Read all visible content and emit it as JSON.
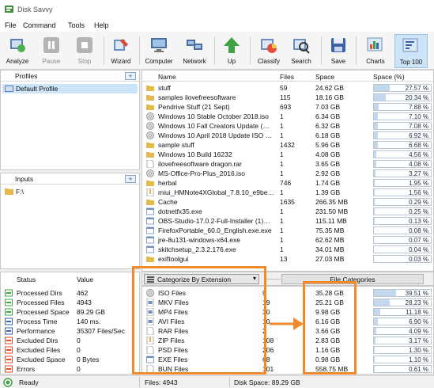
{
  "app": {
    "title": "Disk Savvy"
  },
  "menu": [
    "File",
    "Command",
    "Tools",
    "Help"
  ],
  "toolbar": [
    {
      "label": "Analyze",
      "icon": "analyze-icon",
      "enabled": true
    },
    {
      "label": "Pause",
      "icon": "pause-icon",
      "enabled": false
    },
    {
      "label": "Stop",
      "icon": "stop-icon",
      "enabled": false
    },
    {
      "label": "Wizard",
      "icon": "wizard-icon",
      "enabled": true
    },
    {
      "label": "Computer",
      "icon": "computer-icon",
      "enabled": true
    },
    {
      "label": "Network",
      "icon": "network-icon",
      "enabled": true
    },
    {
      "label": "Up",
      "icon": "up-arrow-icon",
      "enabled": true
    },
    {
      "label": "Classify",
      "icon": "classify-icon",
      "enabled": true
    },
    {
      "label": "Search",
      "icon": "search-icon",
      "enabled": true
    },
    {
      "label": "Save",
      "icon": "save-icon",
      "enabled": true
    },
    {
      "label": "Charts",
      "icon": "charts-icon",
      "enabled": true
    },
    {
      "label": "Top 100",
      "icon": "top100-icon",
      "enabled": true,
      "active": true
    }
  ],
  "profiles": {
    "header": "Profiles",
    "items": [
      "Default Profile"
    ]
  },
  "inputs": {
    "header": "Inputs",
    "items": [
      "F:\\"
    ]
  },
  "status_panel": {
    "col_status": "Status",
    "col_value": "Value",
    "rows": [
      {
        "label": "Processed Dirs",
        "value": "462"
      },
      {
        "label": "Processed Files",
        "value": "4943"
      },
      {
        "label": "Processed Space",
        "value": "89.29 GB"
      },
      {
        "label": "Process Time",
        "value": "140 ms."
      },
      {
        "label": "Performance",
        "value": "35307 Files/Sec"
      },
      {
        "label": "Excluded Dirs",
        "value": "0"
      },
      {
        "label": "Excluded Files",
        "value": "0"
      },
      {
        "label": "Excluded Space",
        "value": "0 Bytes"
      },
      {
        "label": "Errors",
        "value": "0"
      }
    ]
  },
  "file_list": {
    "columns": {
      "name": "Name",
      "files": "Files",
      "space": "Space",
      "pct": "Space (%)"
    },
    "rows": [
      {
        "name": "stuff",
        "type": "folder",
        "files": "59",
        "space": "24.62 GB",
        "pct": "27.57 %",
        "frac": 0.2757
      },
      {
        "name": "samples ilovefreesoftware",
        "type": "folder",
        "files": "115",
        "space": "18.16 GB",
        "pct": "20.34 %",
        "frac": 0.2034
      },
      {
        "name": "Pendrive Stuff (21 Sept)",
        "type": "folder",
        "files": "693",
        "space": "7.03 GB",
        "pct": "7.88 %",
        "frac": 0.0788
      },
      {
        "name": "Windows 10 Stable October 2018.iso",
        "type": "disc",
        "files": "1",
        "space": "6.34 GB",
        "pct": "7.10 %",
        "frac": 0.071
      },
      {
        "name": "Windows 10 Fall Creators Update (…",
        "type": "disc",
        "files": "1",
        "space": "6.32 GB",
        "pct": "7.08 %",
        "frac": 0.0708
      },
      {
        "name": "Windows 10 April 2018 Update ISO …",
        "type": "disc",
        "files": "1",
        "space": "6.18 GB",
        "pct": "6.92 %",
        "frac": 0.0692
      },
      {
        "name": "sample stuff",
        "type": "folder",
        "files": "1432",
        "space": "5.96 GB",
        "pct": "6.68 %",
        "frac": 0.0668
      },
      {
        "name": "Windows 10 Build 16232",
        "type": "folder",
        "files": "1",
        "space": "4.08 GB",
        "pct": "4.56 %",
        "frac": 0.0456
      },
      {
        "name": "ilovefreesoftware dragon.rar",
        "type": "file",
        "files": "1",
        "space": "3.65 GB",
        "pct": "4.08 %",
        "frac": 0.0408
      },
      {
        "name": "MS-Office-Pro-Plus_2016.iso",
        "type": "disc",
        "files": "1",
        "space": "2.92 GB",
        "pct": "3.27 %",
        "frac": 0.0327
      },
      {
        "name": "herbal",
        "type": "folder",
        "files": "746",
        "space": "1.74 GB",
        "pct": "1.95 %",
        "frac": 0.0195
      },
      {
        "name": "miui_HMNote4XGlobal_7.8.10_e9be…",
        "type": "zip",
        "files": "1",
        "space": "1.39 GB",
        "pct": "1.56 %",
        "frac": 0.0156
      },
      {
        "name": "Cache",
        "type": "folder",
        "files": "1635",
        "space": "266.35 MB",
        "pct": "0.29 %",
        "frac": 0.0029
      },
      {
        "name": "dotnetfx35.exe",
        "type": "exe",
        "files": "1",
        "space": "231.50 MB",
        "pct": "0.25 %",
        "frac": 0.0025
      },
      {
        "name": "OBS-Studio-17.0.2-Full-Installer (1)…",
        "type": "exe",
        "files": "1",
        "space": "115.11 MB",
        "pct": "0.13 %",
        "frac": 0.0013
      },
      {
        "name": "FirefoxPortable_60.0_English.exe.exe",
        "type": "exe",
        "files": "1",
        "space": "75.35 MB",
        "pct": "0.08 %",
        "frac": 0.0008
      },
      {
        "name": "jre-8u131-windows-x64.exe",
        "type": "exe",
        "files": "1",
        "space": "62.62 MB",
        "pct": "0.07 %",
        "frac": 0.0007
      },
      {
        "name": "skitchsetup_2.3.2.176.exe",
        "type": "exe",
        "files": "1",
        "space": "34.01 MB",
        "pct": "0.04 %",
        "frac": 0.0004
      },
      {
        "name": "exiftoolgui",
        "type": "folder",
        "files": "13",
        "space": "27.03 MB",
        "pct": "0.03 %",
        "frac": 0.0003
      }
    ]
  },
  "categories": {
    "dropdown_label": "Categorize By Extension",
    "tab_label": "File Categories",
    "rows": [
      {
        "name": "ISO Files",
        "icon": "disc",
        "files": "9",
        "space": "35.28 GB",
        "pct": "39.51 %",
        "frac": 0.3951
      },
      {
        "name": "MKV Files",
        "icon": "video",
        "files": "19",
        "space": "25.21 GB",
        "pct": "28.23 %",
        "frac": 0.2823
      },
      {
        "name": "MP4 Files",
        "icon": "video",
        "files": "30",
        "space": "9.98 GB",
        "pct": "11.18 %",
        "frac": 0.1118
      },
      {
        "name": "AVI Files",
        "icon": "video",
        "files": "10",
        "space": "6.16 GB",
        "pct": "6.90 %",
        "frac": 0.069
      },
      {
        "name": "RAR Files",
        "icon": "doc",
        "files": "2",
        "space": "3.66 GB",
        "pct": "4.09 %",
        "frac": 0.0409
      },
      {
        "name": "ZIP Files",
        "icon": "zip",
        "files": "108",
        "space": "2.83 GB",
        "pct": "3.17 %",
        "frac": 0.0317
      },
      {
        "name": "PSD Files",
        "icon": "doc",
        "files": "206",
        "space": "1.16 GB",
        "pct": "1.30 %",
        "frac": 0.013
      },
      {
        "name": "EXE Files",
        "icon": "exe",
        "files": "68",
        "space": "0.98 GB",
        "pct": "1.10 %",
        "frac": 0.011
      },
      {
        "name": "BUN Files",
        "icon": "doc",
        "files": "101",
        "space": "558.75 MB",
        "pct": "0.61 %",
        "frac": 0.0061
      }
    ]
  },
  "statusbar": {
    "state": "Ready",
    "files": "Files: 4943",
    "disk_space": "Disk Space: 89.29 GB"
  }
}
